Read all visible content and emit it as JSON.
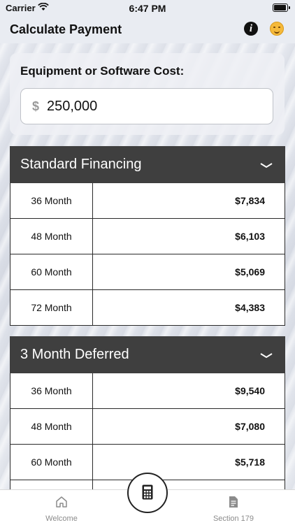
{
  "status_bar": {
    "carrier": "Carrier",
    "time": "6:47 PM"
  },
  "nav": {
    "title": "Calculate Payment",
    "info_icon": "info-icon",
    "avatar_icon": "smiley-face-icon"
  },
  "cost": {
    "label": "Equipment or Software Cost:",
    "currency_symbol": "$",
    "value": "250,000"
  },
  "standard": {
    "title": "Standard Financing",
    "rows": [
      {
        "term": "36 Month",
        "payment": "$7,834"
      },
      {
        "term": "48 Month",
        "payment": "$6,103"
      },
      {
        "term": "60 Month",
        "payment": "$5,069"
      },
      {
        "term": "72 Month",
        "payment": "$4,383"
      }
    ]
  },
  "deferred": {
    "title": "3 Month Deferred",
    "rows": [
      {
        "term": "36 Month",
        "payment": "$9,540"
      },
      {
        "term": "48 Month",
        "payment": "$7,080"
      },
      {
        "term": "60 Month",
        "payment": "$5,718"
      }
    ]
  },
  "tabs": [
    {
      "label": "Welcome",
      "icon": "home-icon"
    },
    {
      "label": "Section 179",
      "icon": "document-icon"
    }
  ],
  "center_tab_icon": "calculator-icon",
  "colors": {
    "header": "#3f3f3f",
    "accent_face": "#f5b93a"
  }
}
